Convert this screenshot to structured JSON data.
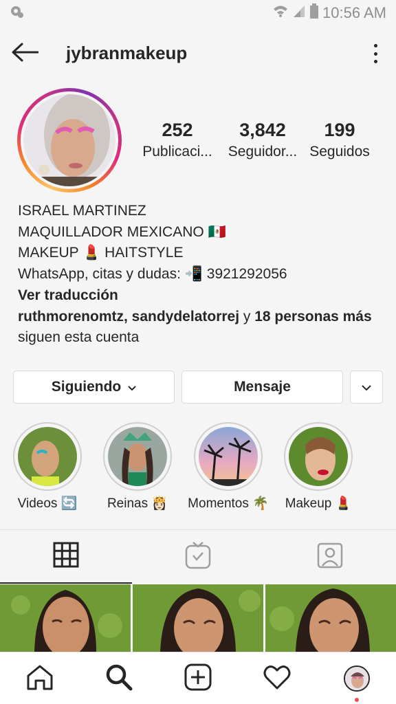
{
  "status_bar": {
    "time": "10:56 AM",
    "icons": [
      "notification-icon",
      "wifi-icon",
      "signal-icon",
      "battery-icon"
    ]
  },
  "header": {
    "username": "jybranmakeup",
    "icons": [
      "back-arrow-icon",
      "more-options-icon"
    ]
  },
  "stats": [
    {
      "value": "252",
      "label": "Publicaci..."
    },
    {
      "value": "3,842",
      "label": "Seguidor..."
    },
    {
      "value": "199",
      "label": "Seguidos"
    }
  ],
  "bio": {
    "name": "ISRAEL MARTINEZ",
    "line1": "MAQUILLADOR MEXICANO 🇲🇽",
    "line2": "MAKEUP 💄 HAITSTYLE",
    "line3": "WhatsApp, citas  y dudas: 📲 3921292056",
    "translate_link": "Ver traducción",
    "followed_by_users": "ruthmorenomtz, sandydelatorrej",
    "followed_by_and": " y ",
    "followed_by_more": "18 personas más",
    "followed_by_tail": "siguen esta cuenta"
  },
  "buttons": {
    "following": "Siguiendo",
    "message": "Mensaje"
  },
  "highlights": [
    {
      "label": "Videos 🔄"
    },
    {
      "label": "Reinas 👸🏻"
    },
    {
      "label": "Momentos 🌴"
    },
    {
      "label": "Makeup 💄"
    }
  ],
  "profile_tabs": [
    "grid-icon",
    "igtv-icon",
    "tagged-icon"
  ],
  "bottom_nav": [
    "home-icon",
    "search-icon",
    "new-post-icon",
    "activity-heart-icon",
    "profile-avatar"
  ],
  "colors": {
    "text": "#262626",
    "secondary": "#8e8e8e",
    "border": "#dbdbdb",
    "background": "#f5f5f5",
    "notification_dot": "#ed4956"
  }
}
